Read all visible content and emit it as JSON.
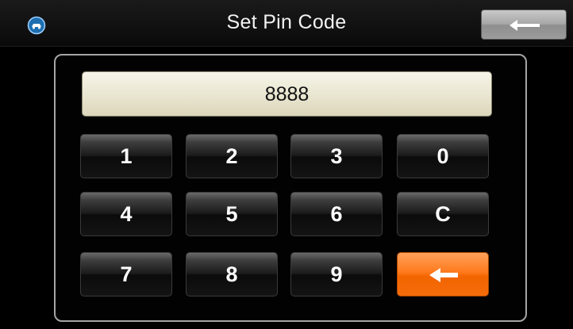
{
  "header": {
    "title": "Set Pin Code",
    "app_icon": "car-icon",
    "back_icon": "arrow-left-icon"
  },
  "display": {
    "value": "8888"
  },
  "keypad": {
    "k1": "1",
    "k2": "2",
    "k3": "3",
    "k0": "0",
    "k4": "4",
    "k5": "5",
    "k6": "6",
    "kc": "C",
    "k7": "7",
    "k8": "8",
    "k9": "9",
    "backspace_icon": "arrow-left-icon"
  },
  "colors": {
    "accent": "#f26500",
    "display_bg": "#ebe8d4",
    "background": "#000000"
  }
}
